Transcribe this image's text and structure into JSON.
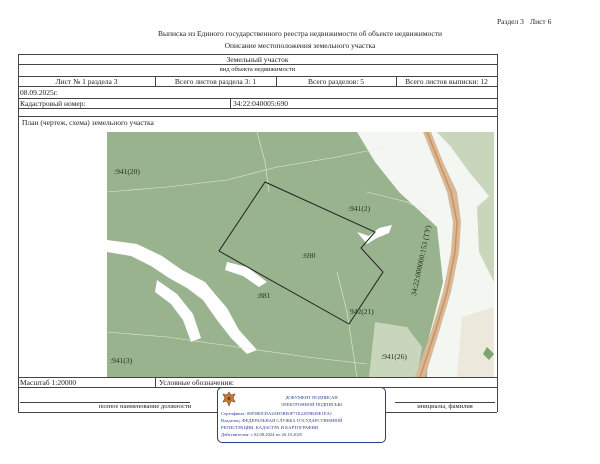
{
  "header": {
    "section_ref": "Раздел 3",
    "sheet_ref": "Лист 6",
    "title": "Выписка из Единого государственного реестра недвижимости об объекте недвижимости",
    "subtitle": "Описание местоположения земельного участка"
  },
  "object": {
    "name": "Земельный участок",
    "name_caption": "вид объекта недвижимости"
  },
  "sheet_info": {
    "sheet_of_section": "Лист № 1 раздела 3",
    "sheets_in_section": "Всего листов раздела 3: 1",
    "sections_total": "Всего разделов: 5",
    "sheets_total": "Всего листов выписки: 12"
  },
  "date": "08.09.2025г.",
  "cadastral": {
    "label": "Кадастровый номер:",
    "value": "34:22:040005:690"
  },
  "plan": {
    "label": "План (чертеж, схема) земельного участка",
    "map_labels": {
      "parcel_main": ":690",
      "parcel_nw": ":941(20)",
      "parcel_ne": ":941(2)",
      "parcel_center": ":881",
      "parcel_se": "942(21)",
      "parcel_sw": ":941(3)",
      "parcel_s": ":941(26)",
      "road": "34:22:000000:153 (ТУ)"
    }
  },
  "footer": {
    "scale": "Масштаб 1:20000",
    "legend": "Условные обозначения:",
    "position_caption": "полное наименование должности",
    "name_caption": "инициалы, фамилия"
  },
  "stamp": {
    "line1": "ДОКУМЕНТ ПОДПИСАН",
    "line2": "ЭЛЕКТРОННОЙ ПОДПИСЬЮ",
    "cert": "Сертификат: 00F5B0CDA4AD5BE0F71E22D9B28E1EA1",
    "owner1": "Владелец: ФЕДЕРАЛЬНАЯ СЛУЖБА ГОСУДАРСТВЕННОЙ",
    "owner2": "РЕГИСТРАЦИИ, КАДАСТРА И КАРТОГРАФИИ",
    "valid": "Действителен: с 02.08.2024 по 26.10.2025"
  },
  "colors": {
    "map_green": "#99b38f",
    "map_light": "#c8d6bb",
    "road": "#c9935f",
    "stamp_blue": "#2b3c8c"
  }
}
